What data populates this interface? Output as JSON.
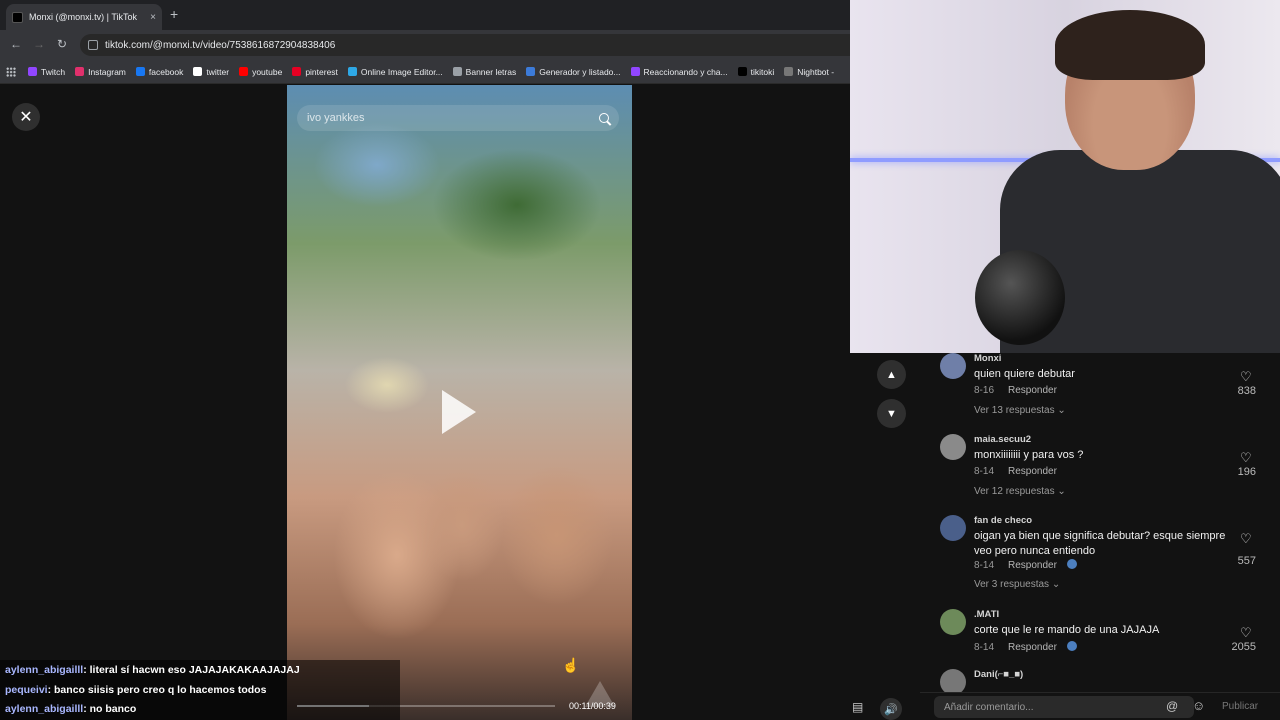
{
  "browser": {
    "tab_title": "Monxi (@monxi.tv) | TikTok",
    "tab_close": "×",
    "new_tab": "+",
    "url": "tiktok.com/@monxi.tv/video/7538616872904838406",
    "bookmarks": [
      {
        "label": "Twitch",
        "color": "#9146ff"
      },
      {
        "label": "Instagram",
        "color": "#e1306c"
      },
      {
        "label": "facebook",
        "color": "#1877f2"
      },
      {
        "label": "twitter",
        "color": "#ffffff"
      },
      {
        "label": "youtube",
        "color": "#ff0000"
      },
      {
        "label": "pinterest",
        "color": "#e60023"
      },
      {
        "label": "Online Image Editor...",
        "color": "#2ea8e6"
      },
      {
        "label": "Banner letras",
        "color": "#9aa0a6"
      },
      {
        "label": "Generador y listado...",
        "color": "#3c7bd9"
      },
      {
        "label": "Reaccionando y cha...",
        "color": "#9146ff"
      },
      {
        "label": "tikitoki",
        "color": "#000000"
      },
      {
        "label": "Nightbot -",
        "color": "#777777"
      }
    ]
  },
  "video": {
    "search_query": "ivo yankkes",
    "timecode": "00:11/00:39",
    "progress": 0.28
  },
  "comments": [
    {
      "user": "Monxi",
      "text": "quien quiere debutar",
      "date": "8-16",
      "reply_label": "Responder",
      "likes": "838",
      "replies": "Ver 13 respuestas",
      "avatar_color": "#6f7fa8",
      "creator_liked": false
    },
    {
      "user": "maia.secuu2",
      "text": "monxiiiiiiii y para vos ?",
      "date": "8-14",
      "reply_label": "Responder",
      "likes": "196",
      "replies": "Ver 12 respuestas",
      "avatar_color": "#8a8a8a",
      "creator_liked": false
    },
    {
      "user": "fan de checo",
      "text": "oigan ya bien que significa debutar? esque siempre veo pero nunca entiendo",
      "date": "8-14",
      "reply_label": "Responder",
      "likes": "557",
      "replies": "Ver 3 respuestas",
      "avatar_color": "#4a5f8a",
      "creator_liked": true
    },
    {
      "user": ".MATI",
      "text": "corte que le re mando de una JAJAJA",
      "date": "8-14",
      "reply_label": "Responder",
      "likes": "2055",
      "replies": "",
      "avatar_color": "#6d8a5a",
      "creator_liked": true
    },
    {
      "user": "Dani(⌐■_■)",
      "text": "",
      "date": "",
      "reply_label": "",
      "likes": "",
      "replies": "",
      "avatar_color": "#777777",
      "creator_liked": false
    }
  ],
  "comment_input": {
    "placeholder": "Añadir comentario...",
    "publish": "Publicar"
  },
  "chat": [
    {
      "user": "aylenn_abigailll",
      "message": ": literal sí hacwn eso JAJAJAKAKAAJAJAJ"
    },
    {
      "user": "pequeivi",
      "message": ": banco siisis pero creo q lo hacemos todos"
    },
    {
      "user": "aylenn_abigailll",
      "message": ": no banco"
    }
  ]
}
